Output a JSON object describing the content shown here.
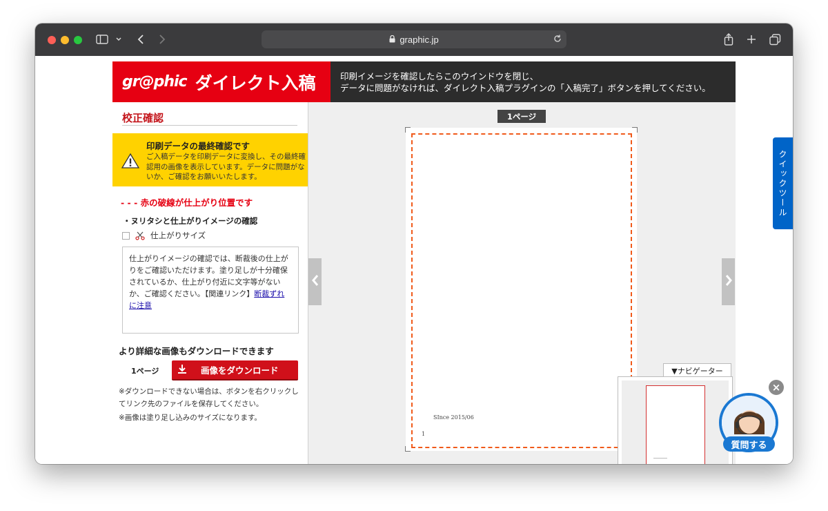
{
  "browser": {
    "url": "graphic.jp"
  },
  "header": {
    "logo_mark": "gr@phic",
    "logo_title": "ダイレクト入稿",
    "message_line1": "印刷イメージを確認したらこのウインドウを閉じ、",
    "message_line2": "データに問題がなければ、ダイレクト入稿プラグインの「入稿完了」ボタンを押してください。"
  },
  "sidebar": {
    "title": "校正確認",
    "notice_title": "印刷データの最終確認です",
    "notice_body": "ご入稿データを印刷データに変換し、その最終確認用の画像を表示しています。データに問題がないか、ご確認をお願いいたします。",
    "trim_legend": "- - - 赤の破線が仕上がり位置です",
    "check_heading": "・ヌリタシと仕上がりイメージの確認",
    "finish_size_label": "仕上がりサイズ",
    "description": "仕上がりイメージの確認では、断裁後の仕上がりをご確認いただけます。塗り足しが十分確保されているか、仕上がり付近に文字等がないか、ご確認ください。【関連リンク】",
    "description_link": "断裁ずれに注意",
    "download_heading": "より詳細な画像もダウンロードできます",
    "download_page": "1ページ",
    "download_button": "画像をダウンロード",
    "note1": "※ダウンロードできない場合は、ボタンを右クリックしてリンク先のファイルを保存してください。",
    "note2": "※画像は塗り足し込みのサイズになります。"
  },
  "preview": {
    "page_label": "1ページ",
    "since_text": "SInce 2015/06",
    "page_number": "1",
    "navigator_label": "▼ナビゲーター"
  },
  "widgets": {
    "quick_tool": "クイックツール",
    "close": "×",
    "chat_label": "質問する"
  },
  "colors": {
    "brand_red": "#e60012",
    "notice_yellow": "#ffd200",
    "trim_orange": "#f05a1a",
    "accent_blue": "#1a78d2"
  }
}
